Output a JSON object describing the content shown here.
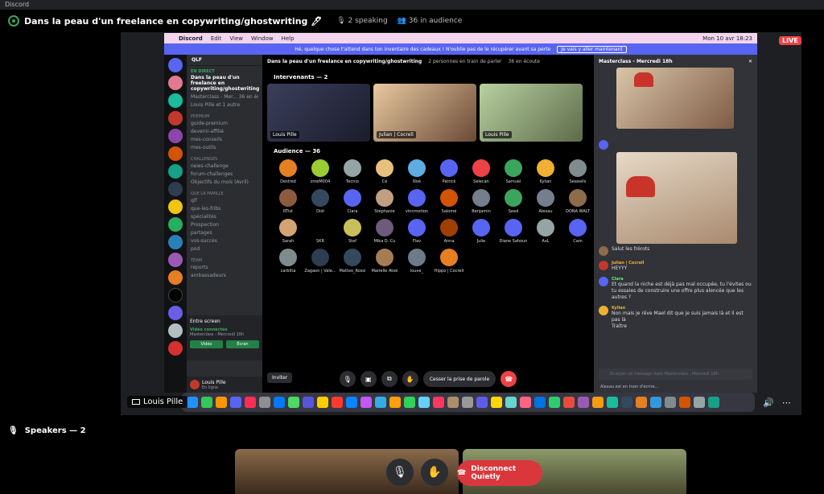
{
  "app": {
    "window_title": "Discord"
  },
  "stage": {
    "title": "Dans la peau d'un freelance en copywriting/ghostwriting",
    "title_emoji": "🖊",
    "speaking": "2 speaking",
    "audience": "36 in audience",
    "live_label": "LIVE",
    "speakers_label": "Speakers — 2",
    "disconnect_label": "Disconnect Quietly"
  },
  "shared_screen": {
    "user": "Louis Pille",
    "mac_menu": [
      "Discord",
      "Edit",
      "View",
      "Window",
      "Help"
    ],
    "clock": "Mon 10 avr  18:23",
    "notice": "Hé, quelque chose t'attend dans ton inventaire des cadeaux ! N'oublie pas de le récupérer avant sa perte",
    "notice_button": "Je vais y aller maintenant",
    "server": "QLF",
    "event_tag": "EN DIRECT",
    "event_title": "Dans la peau d'un freelance en copywriting/ghostwriting",
    "event_meta": "Masterclass - Mer... 36 en écoute",
    "event_host": "Louis Pille et 1 autre",
    "categories": [
      {
        "name": "PREMIUM",
        "items": [
          "guide-premium",
          "devenir-affilié",
          "mes-conseils",
          "mes-outils"
        ]
      },
      {
        "name": "CHALLENGES",
        "items": [
          "news-challenge",
          "forum-challenges",
          "Objectifs du mois (Avril)"
        ]
      },
      {
        "name": "QUE LA FAMILLE",
        "items": [
          "qlf",
          "que-les-fribs",
          "spécialités",
          "Prospection",
          "partages",
          "vos-succès",
          "pod"
        ]
      },
      {
        "name": "TEAM",
        "items": [
          "reports",
          "ambassadeurs"
        ]
      }
    ],
    "voice": {
      "label": "Entre screen",
      "connected": "Vidéo connectée",
      "sub": "Masterclass - Mercredi 18h",
      "btn_video": "Vidéo",
      "btn_screen": "Écran"
    },
    "me": {
      "name": "Louis Pille",
      "status": "En ligne"
    },
    "stage_title": "Dans la peau d'un freelance en copywriting/ghostwriting",
    "stage_speaking": "2 personnes en train de parler",
    "stage_listening": "36 en écoute",
    "speakers_section": "Intervenants — 2",
    "audience_section": "Audience — 36",
    "tiles": [
      "Louis Pille",
      "Julian | Cocrell",
      "Louis Pille"
    ],
    "audience": [
      {
        "name": "Destred",
        "color": "#e67e22"
      },
      {
        "name": "zmeM004",
        "color": "#9acd32"
      },
      {
        "name": "Tecnio",
        "color": "#95a5a6"
      },
      {
        "name": "Cé",
        "color": "#e8c07d"
      },
      {
        "name": "Noé",
        "color": "#5dade2"
      },
      {
        "name": "Patrick",
        "color": "#5865f2"
      },
      {
        "name": "Selecan",
        "color": "#ed4245"
      },
      {
        "name": "Samuel",
        "color": "#3ba55d"
      },
      {
        "name": "Kylian",
        "color": "#f0b132"
      },
      {
        "name": "Seeeells",
        "color": "#7f8c8d"
      },
      {
        "name": "RTist",
        "color": "#8e5a3c"
      },
      {
        "name": "Didi",
        "color": "#34495e"
      },
      {
        "name": "Clara",
        "color": "#5865f2"
      },
      {
        "name": "Stéphanie",
        "color": "#c0a080"
      },
      {
        "name": "vinnmotion",
        "color": "#5865f2"
      },
      {
        "name": "Salomé",
        "color": "#d35400"
      },
      {
        "name": "Benjamin",
        "color": "#747f8d"
      },
      {
        "name": "Seed",
        "color": "#3ba55d"
      },
      {
        "name": "Alexau",
        "color": "#747f8d"
      },
      {
        "name": "DONA WALT",
        "color": "#8e6b4a"
      },
      {
        "name": "Sarah",
        "color": "#d4a373"
      },
      {
        "name": "SKR",
        "color": "#000000"
      },
      {
        "name": "Stef",
        "color": "#c7c05a"
      },
      {
        "name": "Mika D. Cu",
        "color": "#6c5b7b"
      },
      {
        "name": "Flav",
        "color": "#5865f2"
      },
      {
        "name": "Anna",
        "color": "#a04000"
      },
      {
        "name": "Julie",
        "color": "#5865f2"
      },
      {
        "name": "Diane Sahoun",
        "color": "#5865f2"
      },
      {
        "name": "AxL",
        "color": "#95a5a6"
      },
      {
        "name": "Cam",
        "color": "#5865f2"
      },
      {
        "name": "carblita",
        "color": "#7f8c8d"
      },
      {
        "name": "Zagaon | Vale...",
        "color": "#2c3e50"
      },
      {
        "name": "Matteo_Rossi",
        "color": "#34495e"
      },
      {
        "name": "Marielle Atoé",
        "color": "#a67c52"
      },
      {
        "name": "louve_",
        "color": "#6c7a89"
      },
      {
        "name": "Hippo | Cocrell",
        "color": "#e67e22"
      }
    ],
    "invite": "Inviter",
    "end_speaking": "Cesser la prise de parole",
    "chat": {
      "title": "Masterclass - Mercredi 18h",
      "messages": [
        {
          "name": "Julian | Cocrell",
          "text": "HEYYY"
        },
        {
          "name": "Clara",
          "text": "Et quand la niche est déjà pas mal occupée, tu l'évites ou tu essaies de construire une offre plus alencée que les autres ?"
        },
        {
          "name": "Kylian",
          "text": "Non mais je rêve Mael dit que je suis jamais là et il est pas là"
        },
        {
          "name": "",
          "text": "Traître"
        }
      ],
      "top_msg": "Salut les frérots",
      "reply": "Salut les frérots",
      "placeholder": "Envoyer un message dans Masterclass - Mercredi 18h",
      "typing": "Alexau est en train d'écrire..."
    }
  },
  "colors": {
    "live": "#ed4245",
    "accent": "#5865f2",
    "green": "#3ba55d",
    "disconnect": "#da373c"
  }
}
